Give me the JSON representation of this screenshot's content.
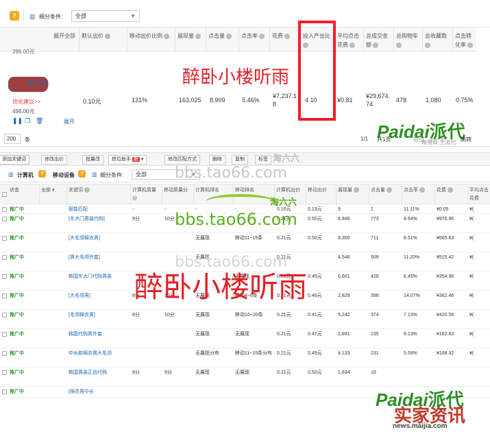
{
  "topbar": {
    "badge": "?",
    "filter_label": "细分条件:",
    "filter_value": "全部"
  },
  "header1": {
    "expand_all": "展开全部",
    "cols": [
      "默认出价",
      "移动出价比例",
      "展现量",
      "点击量",
      "点击率",
      "花费",
      "投入产出比",
      "平均点击花费",
      "总成交金额",
      "总购物车",
      "总收藏数",
      "点击转化率"
    ]
  },
  "prev_price": "396.00元",
  "product": {
    "title": "男士大毛",
    "suggest": "优化建议>>",
    "price": "498.00元",
    "expand": "展开",
    "default_bid": "0.10元",
    "mobile_ratio": "131%",
    "impressions": "163,025",
    "clicks": "8,909",
    "ctr": "5.46%",
    "cost": "¥7,237.18",
    "roi": "4.10",
    "cpc": "¥0.81",
    "gmv": "¥29,674.74",
    "cart": "478",
    "fav": "1,080",
    "cvr": "0.75%"
  },
  "pager": {
    "size": "200",
    "unit": "条",
    "page": "1/1",
    "total": "共1页",
    "prev": "首页",
    "next": "上一页",
    "jump": "跳转"
  },
  "watermarks": {
    "zuiwo": "醉卧小楼听雨",
    "tao_url": "bbs.tao66.com",
    "tao_logo": "淘六六",
    "paidai": "Paidai",
    "paidai_cn": "派代",
    "shijia": "实家资讯",
    "shijia_url": "news.maijia.com",
    "paidai_sub": "做电商 上派代"
  },
  "toolbar2": {
    "buttons": [
      "添加关键词",
      "修改出价",
      "批量改",
      "抢位助手",
      "修改匹配方式",
      "删除",
      "复制",
      "标签"
    ],
    "new_badge": "新"
  },
  "tabs": {
    "pc": "计算机",
    "mobile": "移动设备",
    "filter_label": "细分条件:",
    "filter_value": "全部"
  },
  "header2": {
    "cols": [
      "状态",
      "全部",
      "关键词",
      "计算机质量分",
      "移动质量分",
      "计算机排名",
      "移动排名",
      "计算机出价",
      "移动出价",
      "展现量",
      "点击量",
      "点击率",
      "花费",
      "平均点击花费"
    ]
  },
  "rows": [
    {
      "status": "推广中",
      "keyword": "智能匹配",
      "pcq": "-",
      "mq": "-",
      "pcr": "-",
      "mr": "-",
      "pcb": "0.10元",
      "mb": "0.13元",
      "imp": "9",
      "clk": "1",
      "ctr": "11.11%",
      "cost": "¥0.05",
      "cpc": "¥("
    },
    {
      "status": "推广中",
      "keyword": "[东大门男装代购]",
      "pcq": "9分",
      "mq": "10分",
      "pcr": "",
      "mr": "",
      "pcb": "0.21元",
      "mb": "0.55元",
      "imp": "8,946",
      "clk": "773",
      "ctr": "8.64%",
      "cost": "¥970.96",
      "cpc": "¥("
    },
    {
      "status": "推广中",
      "keyword": "[大毛领棉衣男]",
      "pcq": "",
      "mq": "",
      "pcr": "无展现",
      "mr": "移动11~15条",
      "pcb": "0.21元",
      "mb": "0.50元",
      "imp": "8,350",
      "clk": "711",
      "ctr": "8.51%",
      "cost": "¥665.63",
      "cpc": "¥("
    },
    {
      "status": "推广中",
      "keyword": "[男大毛领外套]",
      "pcq": "",
      "mq": "",
      "pcr": "无展现",
      "mr": "",
      "pcb": "0.21元",
      "mb": "",
      "imp": "4,546",
      "clk": "509",
      "ctr": "11.20%",
      "cost": "¥515.42",
      "cpc": "¥("
    },
    {
      "status": "推广中",
      "keyword": "韩国东大门代购男装",
      "pcq": "",
      "mq": "",
      "pcr": "",
      "mr": "无展现",
      "pcb": "0.21元",
      "mb": "0.49元",
      "imp": "6,601",
      "clk": "426",
      "ctr": "6.45%",
      "cost": "¥354.96",
      "cpc": "¥("
    },
    {
      "status": "推广中",
      "keyword": "[大毛领男]",
      "pcq": "8分",
      "mq": "10分",
      "pcr": "无展现",
      "mr": "移动4~6条",
      "pcb": "0.21元",
      "mb": "0.46元",
      "imp": "2,829",
      "clk": "398",
      "ctr": "14.07%",
      "cost": "¥362.46",
      "cpc": "¥("
    },
    {
      "status": "推广中",
      "keyword": "[毛领棉衣男]",
      "pcq": "8分",
      "mq": "10分",
      "pcr": "无展现",
      "mr": "移动16~20条",
      "pcb": "0.21元",
      "mb": "0.41元",
      "imp": "5,242",
      "clk": "374",
      "ctr": "7.13%",
      "cost": "¥420.56",
      "cpc": "¥("
    },
    {
      "status": "推广中",
      "keyword": "韩国代购男外套",
      "pcq": "",
      "mq": "",
      "pcr": "无展现",
      "mr": "无展现",
      "pcb": "0.21元",
      "mb": "0.47元",
      "imp": "2,891",
      "clk": "235",
      "ctr": "8.13%",
      "cost": "¥162.83",
      "cpc": "¥("
    },
    {
      "status": "推广中",
      "keyword": "中长款棉衣男大毛领",
      "pcq": "",
      "mq": "",
      "pcr": "无展现分布",
      "mr": "移动11~15条分布",
      "pcb": "0.21元",
      "mb": "0.49元",
      "imp": "4,133",
      "clk": "231",
      "ctr": "5.59%",
      "cost": "¥168.32",
      "cpc": "¥("
    },
    {
      "status": "推广中",
      "keyword": "韩国男装正品代购",
      "pcq": "8分",
      "mq": "9分",
      "pcr": "无展现",
      "mr": "无展现",
      "pcb": "0.21元",
      "mb": "0.50元",
      "imp": "1,634",
      "clk": "16",
      "ctr": "",
      "cost": "",
      "cpc": ""
    },
    {
      "status": "推广中",
      "keyword": "[棉衣男中长",
      "pcq": "",
      "mq": "",
      "pcr": "",
      "mr": "",
      "pcb": "",
      "mb": "",
      "imp": "",
      "clk": "",
      "ctr": "",
      "cost": "",
      "cpc": ""
    }
  ]
}
